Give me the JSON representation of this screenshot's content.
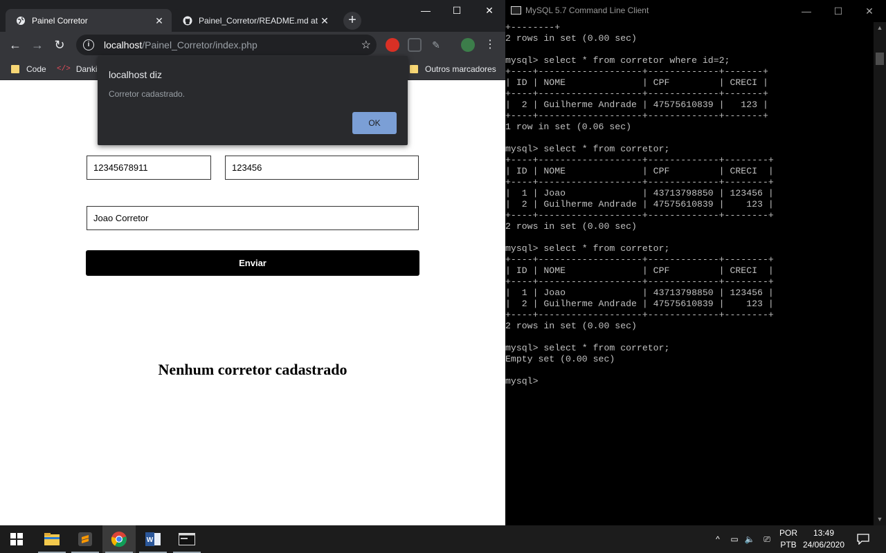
{
  "chrome": {
    "tabs": [
      {
        "title": "Painel Corretor",
        "icon": "globe-icon"
      },
      {
        "title": "Painel_Corretor/README.md at m",
        "icon": "github-icon"
      }
    ],
    "url_host": "localhost",
    "url_path": "/Painel_Corretor/index.php",
    "bookmarks": [
      "Code",
      "Danki",
      "Outros marcadores"
    ]
  },
  "form": {
    "field_cpf": "12345678911",
    "field_creci": "123456",
    "field_nome": "Joao Corretor",
    "submit_label": "Enviar"
  },
  "page_heading": "Nenhum corretor cadastrado",
  "alert": {
    "title": "localhost diz",
    "message": "Corretor cadastrado.",
    "ok_label": "OK"
  },
  "mysql": {
    "window_title": "MySQL 5.7 Command Line Client",
    "console_text": "+--------+\n2 rows in set (0.00 sec)\n\nmysql> select * from corretor where id=2;\n+----+-------------------+-------------+-------+\n| ID | NOME              | CPF         | CRECI |\n+----+-------------------+-------------+-------+\n|  2 | Guilherme Andrade | 47575610839 |   123 |\n+----+-------------------+-------------+-------+\n1 row in set (0.06 sec)\n\nmysql> select * from corretor;\n+----+-------------------+-------------+--------+\n| ID | NOME              | CPF         | CRECI  |\n+----+-------------------+-------------+--------+\n|  1 | Joao              | 43713798850 | 123456 |\n|  2 | Guilherme Andrade | 47575610839 |    123 |\n+----+-------------------+-------------+--------+\n2 rows in set (0.00 sec)\n\nmysql> select * from corretor;\n+----+-------------------+-------------+--------+\n| ID | NOME              | CPF         | CRECI  |\n+----+-------------------+-------------+--------+\n|  1 | Joao              | 43713798850 | 123456 |\n|  2 | Guilherme Andrade | 47575610839 |    123 |\n+----+-------------------+-------------+--------+\n2 rows in set (0.00 sec)\n\nmysql> select * from corretor;\nEmpty set (0.00 sec)\n\nmysql>"
  },
  "taskbar": {
    "language_top": "POR",
    "language_bottom": "PTB",
    "time": "13:49",
    "date": "24/06/2020"
  }
}
